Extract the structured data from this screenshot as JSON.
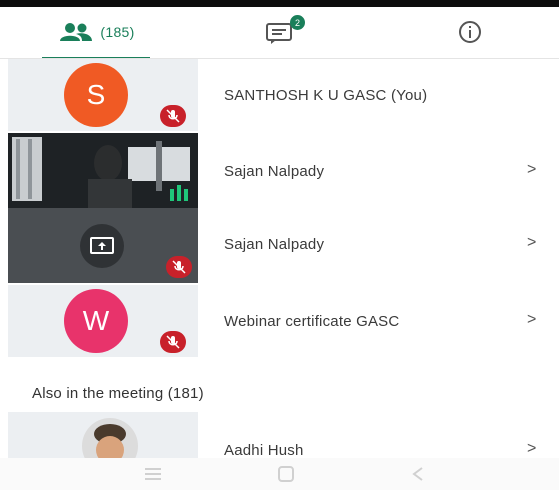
{
  "tabs": {
    "participants_label": "(185)",
    "chat_badge": "2"
  },
  "participants": [
    {
      "initial": "S",
      "name": "SANTHOSH K U GASC (You)",
      "color": "#f05a24"
    },
    {
      "name": "Sajan Nalpady"
    },
    {
      "name": "Sajan Nalpady"
    },
    {
      "initial": "W",
      "name": "Webinar certificate GASC",
      "color": "#e8336b"
    }
  ],
  "also_section": {
    "title": "Also in the meeting (181)",
    "first_name": "Aadhi Hush"
  },
  "chevron": ">",
  "colors": {
    "accent": "#1a7f5a",
    "mic_muted": "#c8212a"
  }
}
